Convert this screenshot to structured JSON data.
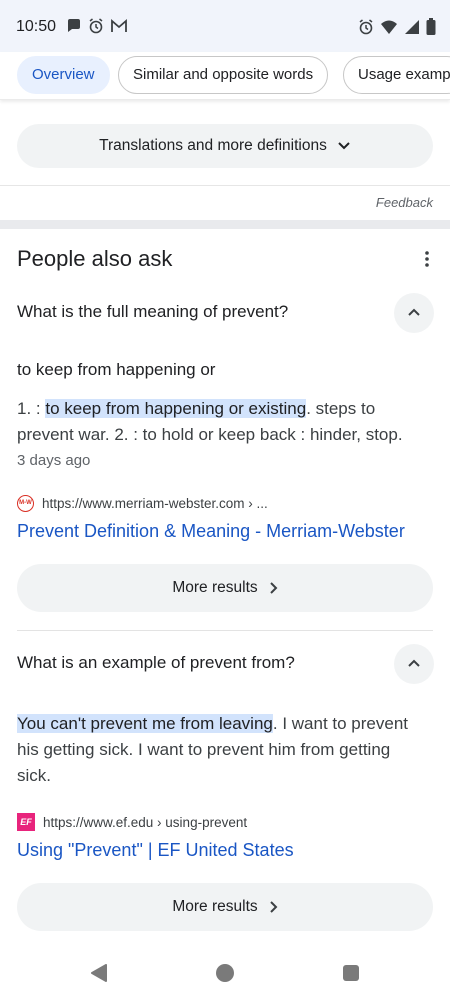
{
  "status_bar": {
    "time": "10:50",
    "left_icons": [
      "chat-bubble-icon",
      "alarm-icon",
      "gmail-icon"
    ],
    "right_icons": [
      "alarm-icon",
      "wifi-icon",
      "signal-icon",
      "battery-icon"
    ]
  },
  "chips": [
    {
      "label": "Overview",
      "active": true
    },
    {
      "label": "Similar and opposite words",
      "active": false
    },
    {
      "label": "Usage examp",
      "active": false
    }
  ],
  "translations_button": {
    "label": "Translations and more definitions"
  },
  "feedback_label": "Feedback",
  "people_also_ask": {
    "title": "People also ask",
    "items": [
      {
        "question": "What is the full meaning of prevent?",
        "snippet_heading": "to keep from happening or",
        "answer_prefix": "1. : ",
        "answer_highlight": "to keep from happening or existing",
        "answer_rest": ". steps to prevent war. 2. : to hold or keep back : hinder, stop.",
        "date": "3 days ago",
        "source_url": "https://www.merriam-webster.com › ...",
        "favicon_text": "M-W",
        "link_title": "Prevent Definition & Meaning - Merriam-Webster",
        "more_label": "More results"
      },
      {
        "question": "What is an example of prevent from?",
        "answer_highlight": "You can't prevent me from leaving",
        "answer_rest": ". I want to prevent his getting sick. I want to prevent him from getting sick.",
        "source_url": "https://www.ef.edu › using-prevent",
        "favicon_text": "EF",
        "link_title": "Using \"Prevent\" | EF United States",
        "more_label": "More results"
      }
    ]
  },
  "colors": {
    "link": "#1a56c4",
    "highlight": "#d2e3fc",
    "active_chip_bg": "#e8f0fe",
    "pill_bg": "#f1f3f4"
  }
}
